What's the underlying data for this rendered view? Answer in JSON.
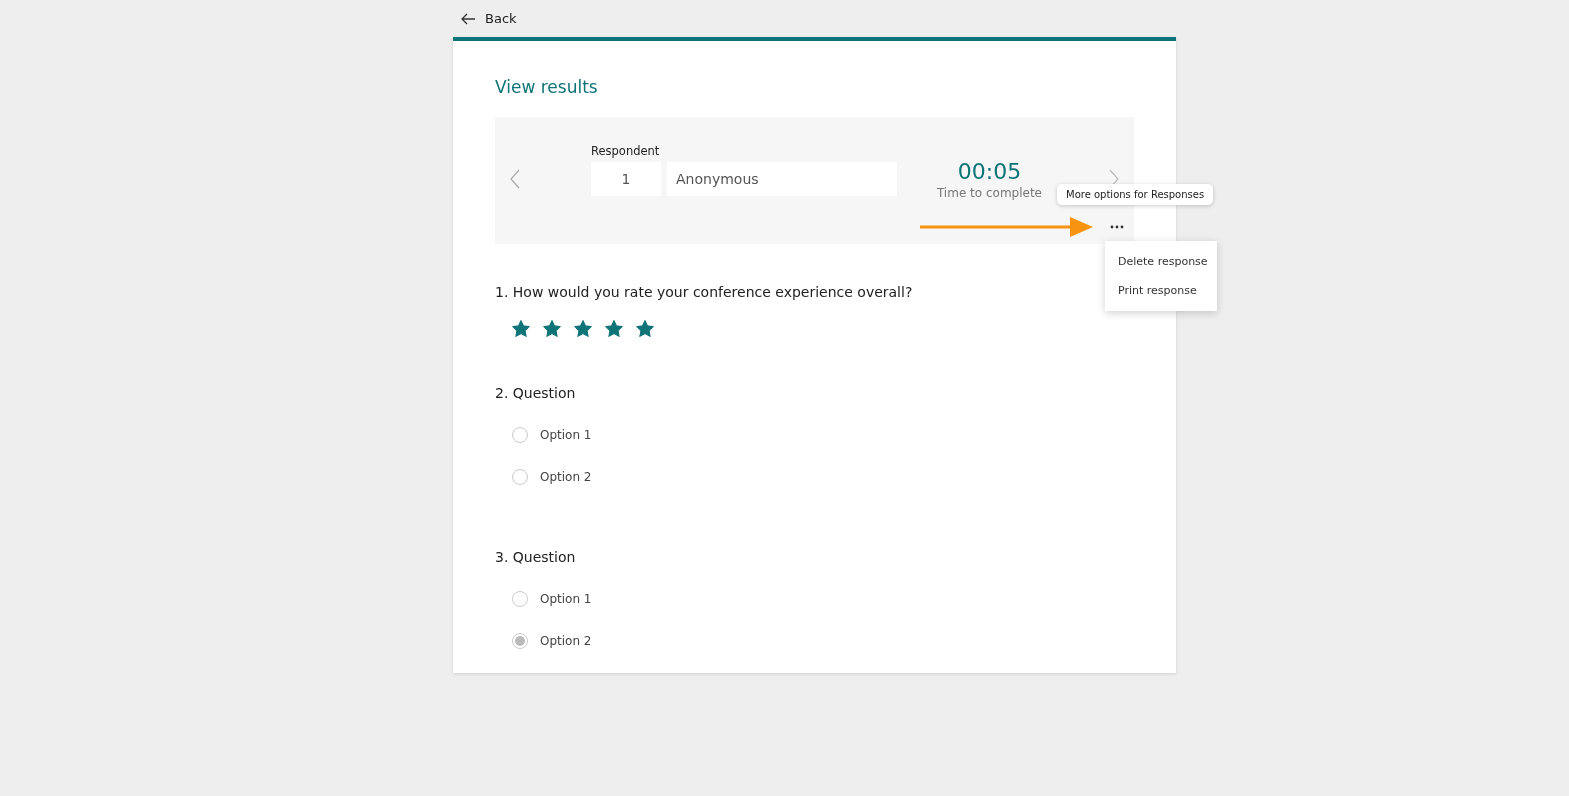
{
  "back": {
    "label": "Back"
  },
  "title": "View results",
  "respondent": {
    "label": "Respondent",
    "number": "1",
    "name": "Anonymous",
    "time": "00:05",
    "time_label": "Time to complete"
  },
  "tooltip": "More options for Responses",
  "menu": [
    "Delete response",
    "Print response"
  ],
  "questions": [
    {
      "kind": "rating",
      "title": "1. How would you rate your conference experience overall?",
      "stars": 5
    },
    {
      "kind": "choice",
      "title": "2. Question",
      "options": [
        {
          "label": "Option 1",
          "selected": false
        },
        {
          "label": "Option 2",
          "selected": false
        }
      ]
    },
    {
      "kind": "choice",
      "title": "3. Question",
      "options": [
        {
          "label": "Option 1",
          "selected": false
        },
        {
          "label": "Option 2",
          "selected": true
        }
      ]
    }
  ]
}
